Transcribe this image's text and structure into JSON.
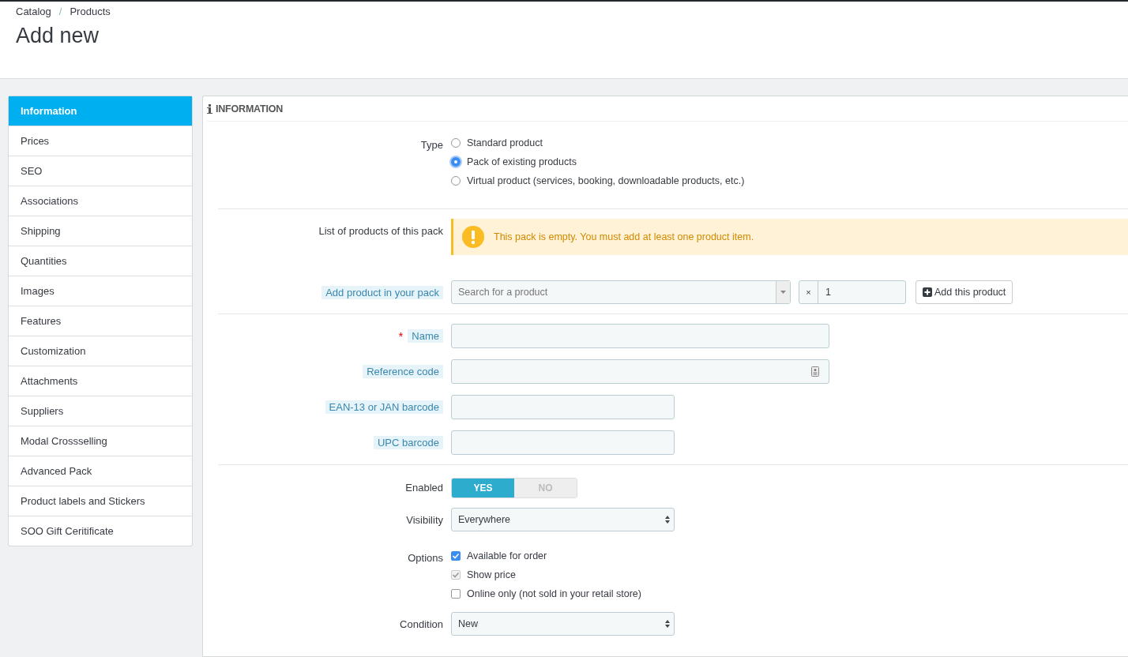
{
  "breadcrumb": [
    "Catalog",
    "Products"
  ],
  "breadcrumb_separator": "/",
  "page_title": "Add new",
  "sidebar": {
    "items": [
      {
        "label": "Information",
        "selected": true
      },
      {
        "label": "Prices",
        "selected": false
      },
      {
        "label": "SEO",
        "selected": false
      },
      {
        "label": "Associations",
        "selected": false
      },
      {
        "label": "Shipping",
        "selected": false
      },
      {
        "label": "Quantities",
        "selected": false
      },
      {
        "label": "Images",
        "selected": false
      },
      {
        "label": "Features",
        "selected": false
      },
      {
        "label": "Customization",
        "selected": false
      },
      {
        "label": "Attachments",
        "selected": false
      },
      {
        "label": "Suppliers",
        "selected": false
      },
      {
        "label": "Modal Crossselling",
        "selected": false
      },
      {
        "label": "Advanced Pack",
        "selected": false
      },
      {
        "label": "Product labels and Stickers",
        "selected": false
      },
      {
        "label": "SOO Gift Ceritificate",
        "selected": false
      }
    ]
  },
  "panel": {
    "title": "INFORMATION",
    "sections": [
      {
        "fields": [
          {
            "kind": "radio",
            "label": "Type",
            "options": [
              {
                "label": "Standard product",
                "selected": false
              },
              {
                "label": "Pack of existing products",
                "selected": true
              },
              {
                "label": "Virtual product (services, booking, downloadable products, etc.)",
                "selected": false
              }
            ]
          }
        ]
      },
      {
        "fields": [
          {
            "kind": "alert",
            "label": "List of products of this pack",
            "message": "This pack is empty. You must add at least one product item."
          },
          {
            "kind": "search",
            "label": "Add product in your pack",
            "hint": true,
            "placeholder": "Search for a product",
            "quantity_prefix": "×",
            "quantity": "1",
            "button": "Add this product"
          }
        ]
      },
      {
        "fields": [
          {
            "kind": "wide_text",
            "label": "Name",
            "hint": true,
            "required": true,
            "required_mark": "*"
          },
          {
            "kind": "wide_text",
            "label": "Reference code",
            "hint": true,
            "icon": true
          },
          {
            "kind": "text",
            "label": "EAN-13 or JAN barcode",
            "hint": true
          },
          {
            "kind": "text",
            "label": "UPC barcode",
            "hint": true
          }
        ]
      },
      {
        "fields": [
          {
            "kind": "switch",
            "label": "Enabled",
            "options": [
              {
                "label": "YES",
                "selected": true
              },
              {
                "label": "NO",
                "selected": false
              }
            ]
          },
          {
            "kind": "select",
            "label": "Visibility",
            "value": "Everywhere"
          },
          {
            "kind": "checkbox",
            "label": "Options",
            "options": [
              {
                "label": "Available for order",
                "checked": true,
                "disabled": false
              },
              {
                "label": "Show price",
                "checked": true,
                "disabled": true
              },
              {
                "label": "Online only (not sold in your retail store)",
                "checked": false,
                "disabled": false
              }
            ]
          },
          {
            "kind": "select",
            "label": "Condition",
            "value": "New"
          }
        ]
      }
    ]
  }
}
